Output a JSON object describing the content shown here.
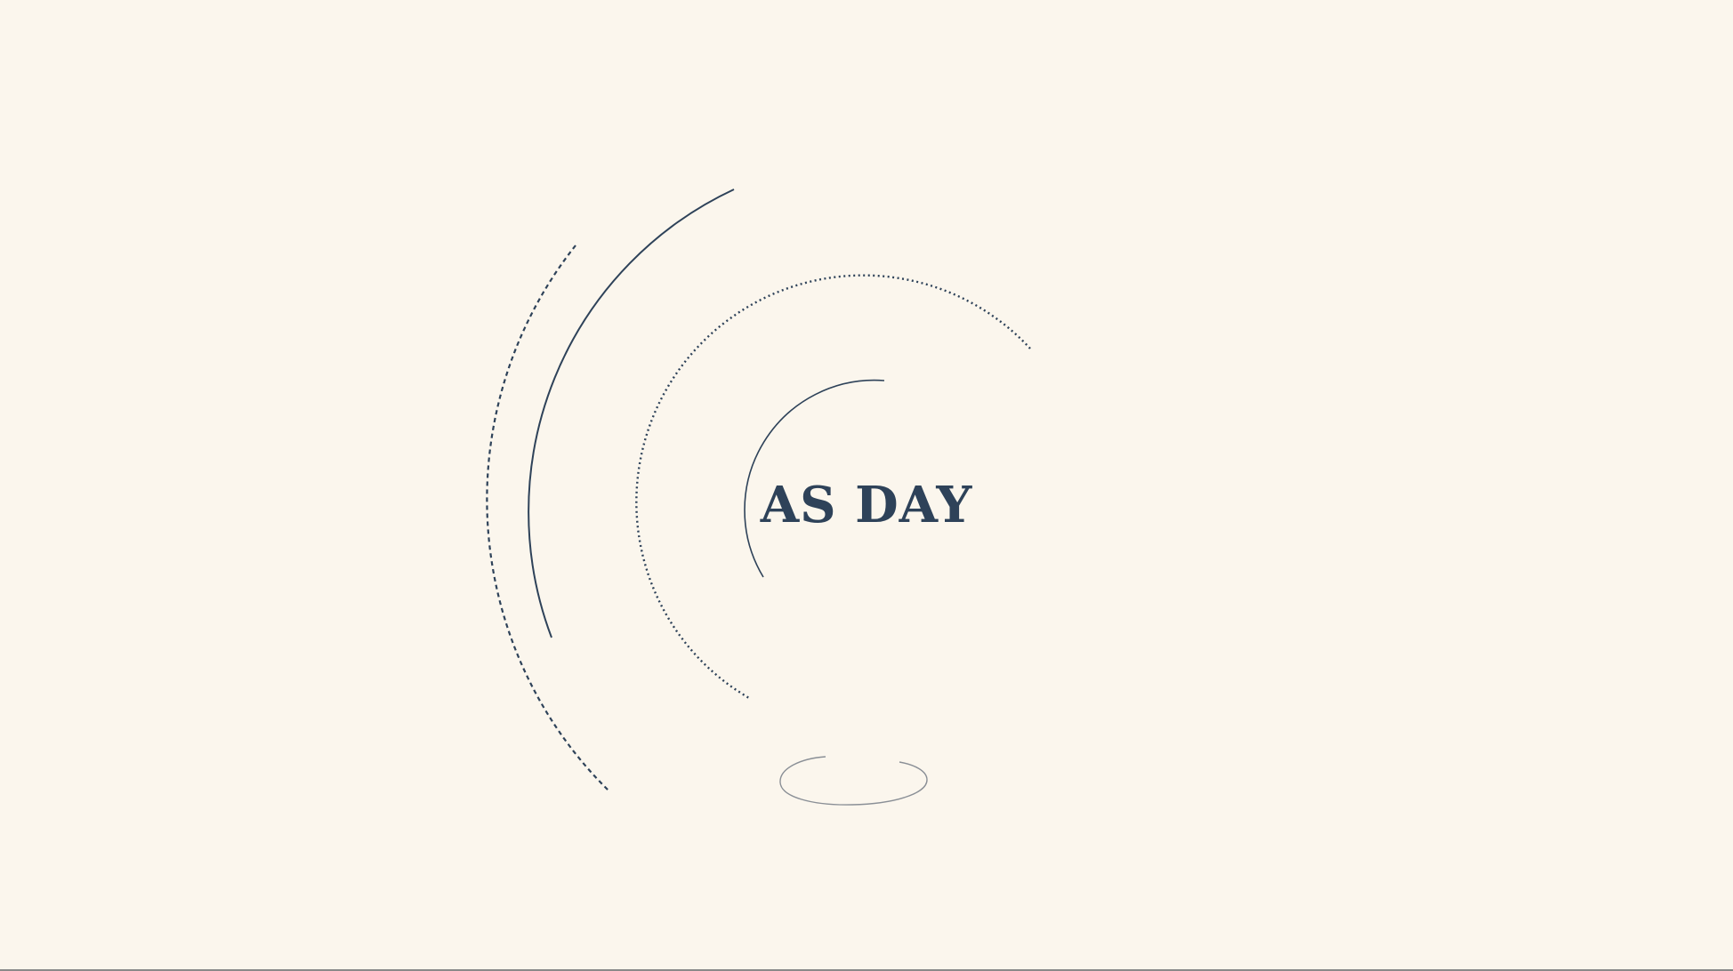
{
  "title": "AS DAY",
  "colors": {
    "background": "#fbf6ed",
    "ink": "#2e4259",
    "faint": "#8a8f96"
  }
}
